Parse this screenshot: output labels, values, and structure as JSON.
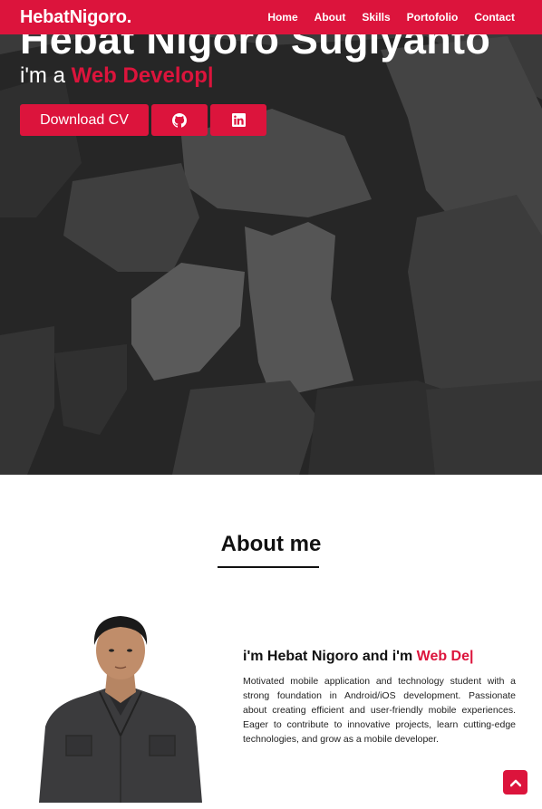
{
  "navbar": {
    "brand": "HebatNigoro.",
    "items": [
      "Home",
      "About",
      "Skills",
      "Portofolio",
      "Contact"
    ]
  },
  "hero": {
    "name": "Hebat Nigoro Sugiyanto",
    "subtitle_prefix": "i'm a ",
    "subtitle_typed": "Web Develop|",
    "download_label": "Download CV",
    "github_icon": "github-icon",
    "linkedin_icon": "linkedin-icon"
  },
  "about": {
    "title": "About me",
    "heading_prefix": "i'm Hebat Nigoro and i'm ",
    "heading_typed": "Web De|",
    "description": "Motivated mobile application and technology student with a strong foundation in Android/iOS development. Passionate about creating efficient and user-friendly mobile experiences. Eager to contribute to innovative projects, learn cutting-edge technologies, and grow as a mobile developer."
  },
  "back_to_top_icon": "chevron-up-icon",
  "colors": {
    "accent": "#dc143c",
    "hero_bg": "#2a2a2a"
  }
}
